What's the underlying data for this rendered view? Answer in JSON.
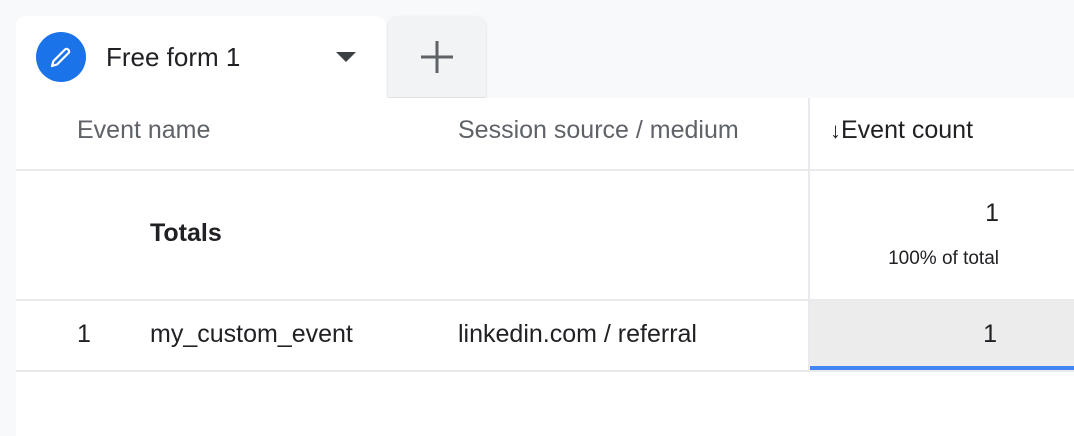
{
  "tabs": [
    {
      "label": "Free form 1",
      "icon": "pencil-icon"
    }
  ],
  "add_tab": {
    "icon": "plus-icon"
  },
  "table": {
    "columns": [
      "Event name",
      "Session source / medium",
      "Event count"
    ],
    "sort": {
      "column": "Event count",
      "direction": "descending",
      "icon": "arrow-down-icon"
    },
    "totals": {
      "label": "Totals",
      "event_count": "1",
      "percent": "100% of total"
    },
    "rows": [
      {
        "index": "1",
        "event_name": "my_custom_event",
        "source_medium": "linkedin.com / referral",
        "event_count": "1"
      }
    ]
  },
  "colors": {
    "accent": "#1a73e8",
    "selection_bar": "#4285f4"
  }
}
